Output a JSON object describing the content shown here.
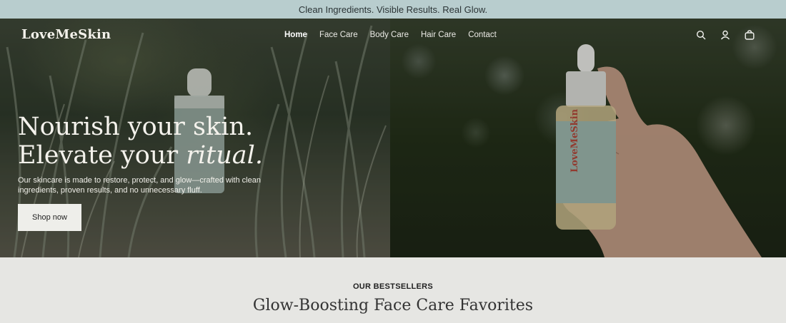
{
  "announcement": "Clean Ingredients. Visible Results. Real Glow.",
  "header": {
    "logo": "LoveMeSkin",
    "nav": [
      {
        "label": "Home",
        "active": true
      },
      {
        "label": "Face Care",
        "active": false
      },
      {
        "label": "Body Care",
        "active": false
      },
      {
        "label": "Hair Care",
        "active": false
      },
      {
        "label": "Contact",
        "active": false
      }
    ],
    "icons": [
      "search-icon",
      "account-icon",
      "cart-icon"
    ]
  },
  "hero": {
    "headline_line1": "Nourish your skin.",
    "headline_line2_plain": "Elevate your ",
    "headline_line2_italic": "ritual.",
    "subtext": "Our skincare is made to restore, protect, and glow—crafted with clean ingredients, proven results, and no unnecessary fluff.",
    "cta_label": "Shop now",
    "product_label_brand": "LoveMeSkin"
  },
  "bestsellers": {
    "kicker": "OUR BESTSELLERS",
    "title": "Glow-Boosting Face Care Favorites"
  },
  "colors": {
    "announcement_bg": "#b8cdce",
    "page_bg": "#e6e6e3",
    "bottle_label": "#9db6ad",
    "brand_red": "#b3473a"
  }
}
